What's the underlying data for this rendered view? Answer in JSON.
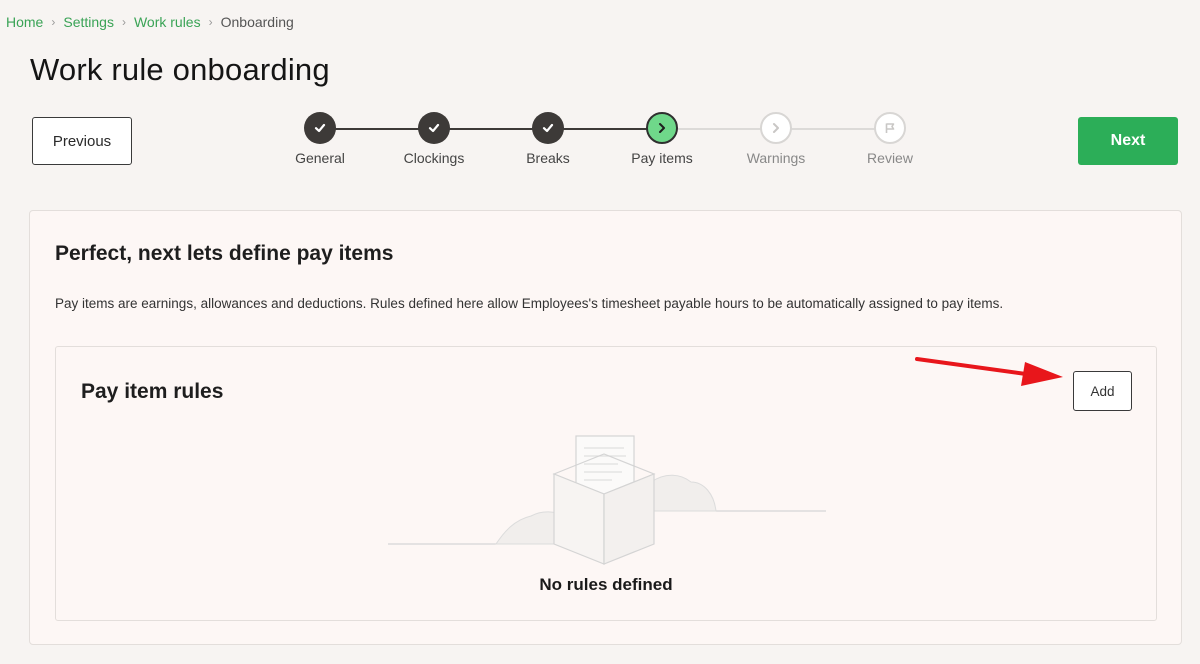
{
  "breadcrumb": {
    "items": [
      "Home",
      "Settings",
      "Work rules"
    ],
    "current": "Onboarding"
  },
  "page": {
    "title": "Work rule onboarding"
  },
  "nav": {
    "previous_label": "Previous",
    "next_label": "Next"
  },
  "stepper": {
    "steps": [
      {
        "label": "General",
        "state": "done"
      },
      {
        "label": "Clockings",
        "state": "done"
      },
      {
        "label": "Breaks",
        "state": "done"
      },
      {
        "label": "Pay items",
        "state": "current"
      },
      {
        "label": "Warnings",
        "state": "future"
      },
      {
        "label": "Review",
        "state": "future"
      }
    ]
  },
  "card": {
    "title": "Perfect, next lets define pay items",
    "description": "Pay items are earnings, allowances and deductions. Rules defined here allow Employees's timesheet payable hours to be automatically assigned to pay items."
  },
  "pay_item_rules": {
    "title": "Pay item rules",
    "add_label": "Add",
    "empty_text": "No rules defined"
  },
  "colors": {
    "accent_green": "#2cae58",
    "current_step": "#6fd88a",
    "done_step": "#3d3a38",
    "annotation_arrow": "#e8161b"
  }
}
